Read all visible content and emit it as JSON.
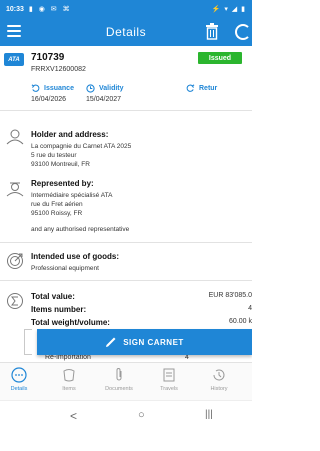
{
  "status_bar": {
    "time": "10:33"
  },
  "app_bar": {
    "title": "Details"
  },
  "carnet": {
    "logo_text": "ATA",
    "number": "710739",
    "reference": "FRRXV12600082",
    "status": "Issued",
    "issuance_label": "Issuance",
    "issuance_date": "16/04/2026",
    "validity_label": "Validity",
    "validity_date": "15/04/2027",
    "return_label": "Retur"
  },
  "holder": {
    "title": "Holder and address:",
    "lines": [
      "La compagnie du Carnet ATA 2025",
      "5 rue du testeur",
      "93100 Montreuil, FR"
    ]
  },
  "represented": {
    "title": "Represented by:",
    "lines": [
      "Intermédiaire spécialisé ATA",
      "rue du Fret aérien",
      "95100 Roissy, FR",
      "and any authorised representative"
    ]
  },
  "use": {
    "title": "Intended use of goods:",
    "value": "Professional equipment"
  },
  "totals": {
    "value_label": "Total value:",
    "value": "EUR 83'085.0",
    "items_label": "Items number:",
    "items": "4",
    "weight_label": "Total weight/volume:",
    "weight": "60.00 k"
  },
  "reimport": {
    "label": "Re-importation",
    "count": "4"
  },
  "sign_button": {
    "label": "SIGN CARNET"
  },
  "nav": [
    {
      "label": "Details",
      "icon": "details-icon"
    },
    {
      "label": "Items",
      "icon": "items-icon"
    },
    {
      "label": "Documents",
      "icon": "documents-icon"
    },
    {
      "label": "Travels",
      "icon": "travels-icon"
    },
    {
      "label": "History",
      "icon": "history-icon"
    }
  ],
  "colors": {
    "primary": "#1f86d6",
    "issued": "#2bb52e"
  }
}
